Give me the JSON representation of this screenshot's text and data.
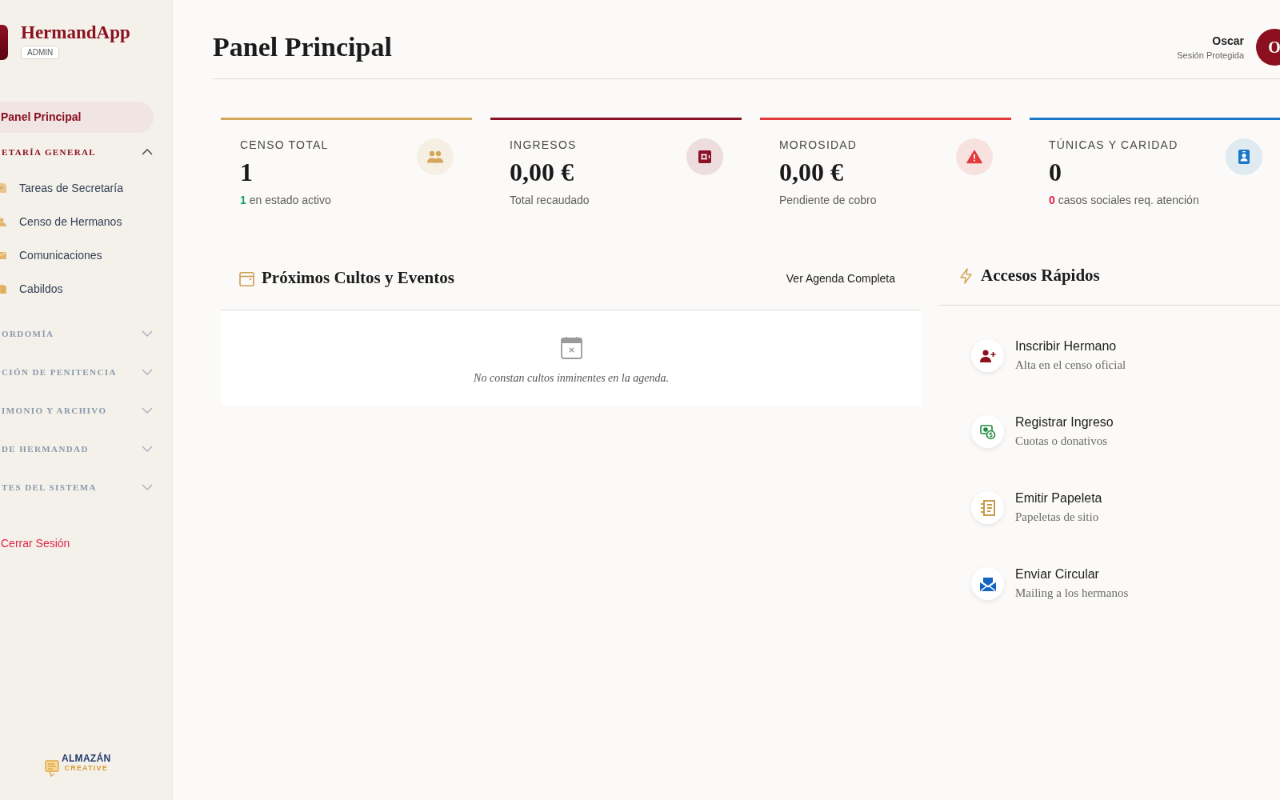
{
  "sidebar": {
    "brand": {
      "name": "HermandApp",
      "badge": "ADMIN"
    },
    "nav": [
      {
        "kind": "link",
        "label": "Panel Principal",
        "selected": true
      },
      {
        "kind": "section",
        "label": "ETARÍA GENERAL",
        "expanded": true,
        "children": [
          {
            "label": "Tareas de Secretaría",
            "selected": false
          },
          {
            "label": "Censo de Hermanos",
            "selected": false
          },
          {
            "label": "Comunicaciones",
            "selected": false
          },
          {
            "label": "Cabildos",
            "selected": false
          }
        ]
      },
      {
        "kind": "section",
        "label": "ORDOMÍA",
        "expanded": false
      },
      {
        "kind": "section",
        "label": "CIÓN DE PENITENCIA",
        "expanded": false
      },
      {
        "kind": "section",
        "label": "IMONIO Y ARCHIVO",
        "expanded": false
      },
      {
        "kind": "section",
        "label": "DE HERMANDAD",
        "expanded": false
      },
      {
        "kind": "section",
        "label": "TES DEL SISTEMA",
        "expanded": false
      }
    ],
    "logout": "Cerrar Sesión",
    "footer_logo": {
      "wordmark": "ALMAZÁN",
      "tagline": "CREATIVE"
    }
  },
  "header": {
    "title": "Panel Principal",
    "user": {
      "name": "Oscar",
      "status": "Sesión Protegida",
      "initial": "O"
    }
  },
  "stats": [
    {
      "label": "CENSO TOTAL",
      "value": "1",
      "count": "1",
      "count_alert": false,
      "note": "en estado activo",
      "color": "#d2a75c"
    },
    {
      "label": "INGRESOS",
      "value": "0,00 €",
      "note": "Total recaudado",
      "color": "#8b1226"
    },
    {
      "label": "MOROSIDAD",
      "value": "0,00 €",
      "note": "Pendiente de cobro",
      "color": "#e23b3b"
    },
    {
      "label": "TÚNICAS Y CARIDAD",
      "value": "0",
      "count": "0",
      "count_alert": true,
      "note": "casos sociales req. atención",
      "color": "#1a78c8"
    }
  ],
  "events": {
    "title": "Próximos Cultos y Eventos",
    "link": "Ver Agenda Completa",
    "empty_message": "No constan cultos inminentes en la agenda."
  },
  "quick_access": {
    "title": "Accesos Rápidos",
    "items": [
      {
        "title": "Inscribir Hermano",
        "subtitle": "Alta en el censo oficial",
        "color": "#8b1020"
      },
      {
        "title": "Registrar Ingreso",
        "subtitle": "Cuotas o donativos",
        "color": "#1f8a3c"
      },
      {
        "title": "Emitir Papeleta",
        "subtitle": "Papeletas de sitio",
        "color": "#c99a4a"
      },
      {
        "title": "Enviar Circular",
        "subtitle": "Mailing a los hermanos",
        "color": "#1565c0"
      }
    ]
  }
}
